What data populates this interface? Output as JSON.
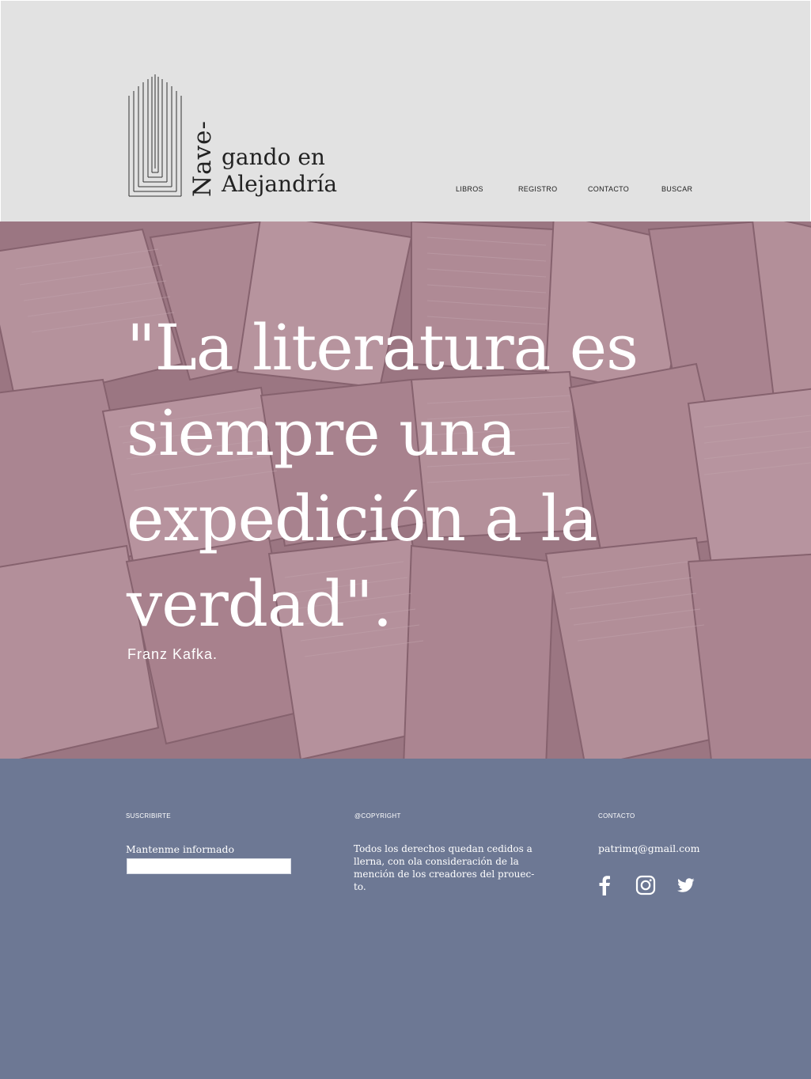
{
  "header": {
    "logo": {
      "line_vertical": "Nave-",
      "line1": "gando en",
      "line2": "Alejandría"
    },
    "nav": [
      {
        "label": "LIBROS"
      },
      {
        "label": "REGISTRO"
      },
      {
        "label": "CONTACTO"
      },
      {
        "label": "BUSCAR"
      }
    ]
  },
  "hero": {
    "quote": "\"La literatura es siempre una expedición a la verdad\".",
    "author": "Franz Kafka."
  },
  "footer": {
    "subscribe": {
      "heading": "SUSCRIBIRTE",
      "label": "Mantenme informado",
      "input_value": ""
    },
    "copyright": {
      "heading": "@COPYRIGHT",
      "text": "Todos los derechos quedan cedidos a llerna, con ola consideración de la mención de los creadores del prouec- to."
    },
    "contact": {
      "heading": "CONTACTO",
      "email": "patrimq@gmail.com",
      "social_icons": [
        "facebook-icon",
        "instagram-icon",
        "twitter-icon"
      ]
    }
  },
  "colors": {
    "header_bg": "#e2e2e2",
    "hero_tint": "#a07d86",
    "footer_bg": "#6d7894",
    "text_dark": "#222222",
    "text_light": "#ffffff"
  }
}
